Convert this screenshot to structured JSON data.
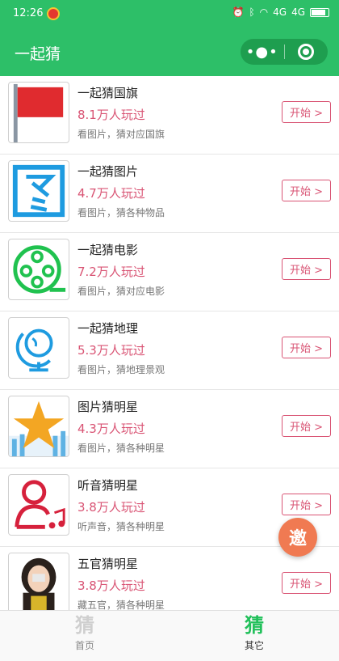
{
  "status_bar": {
    "time": "12:26",
    "network": "4G",
    "signal": "4G"
  },
  "nav": {
    "title": "一起猜",
    "more_label": "•●•"
  },
  "games": [
    {
      "name": "一起猜国旗",
      "plays": "8.1万人玩过",
      "desc": "看图片，猜对应国旗",
      "button": "开始 >",
      "icon": "red-flag-icon"
    },
    {
      "name": "一起猜图片",
      "plays": "4.7万人玩过",
      "desc": "看图片，猜各种物品",
      "button": "开始 >",
      "icon": "picture-character-icon"
    },
    {
      "name": "一起猜电影",
      "plays": "7.2万人玩过",
      "desc": "看图片，猜对应电影",
      "button": "开始 >",
      "icon": "film-reel-icon"
    },
    {
      "name": "一起猜地理",
      "plays": "5.3万人玩过",
      "desc": "看图片，猜地理景观",
      "button": "开始 >",
      "icon": "globe-icon"
    },
    {
      "name": "图片猜明星",
      "plays": "4.3万人玩过",
      "desc": "看图片，猜各种明星",
      "button": "开始 >",
      "icon": "star-icon"
    },
    {
      "name": "听音猜明星",
      "plays": "3.8万人玩过",
      "desc": "听声音，猜各种明星",
      "button": "开始 >",
      "icon": "person-music-icon"
    },
    {
      "name": "五官猜明星",
      "plays": "3.8万人玩过",
      "desc": "藏五官，猜各种明星",
      "button": "开始 >",
      "icon": "face-portrait-icon"
    }
  ],
  "invite": {
    "label": "邀"
  },
  "tabs": [
    {
      "icon_char": "猜",
      "label": "首页",
      "active": false
    },
    {
      "icon_char": "猜",
      "label": "其它",
      "active": true
    }
  ],
  "colors": {
    "brand_green": "#2dbf68",
    "accent_pink": "#d95474",
    "invite_orange": "#f07a52"
  }
}
